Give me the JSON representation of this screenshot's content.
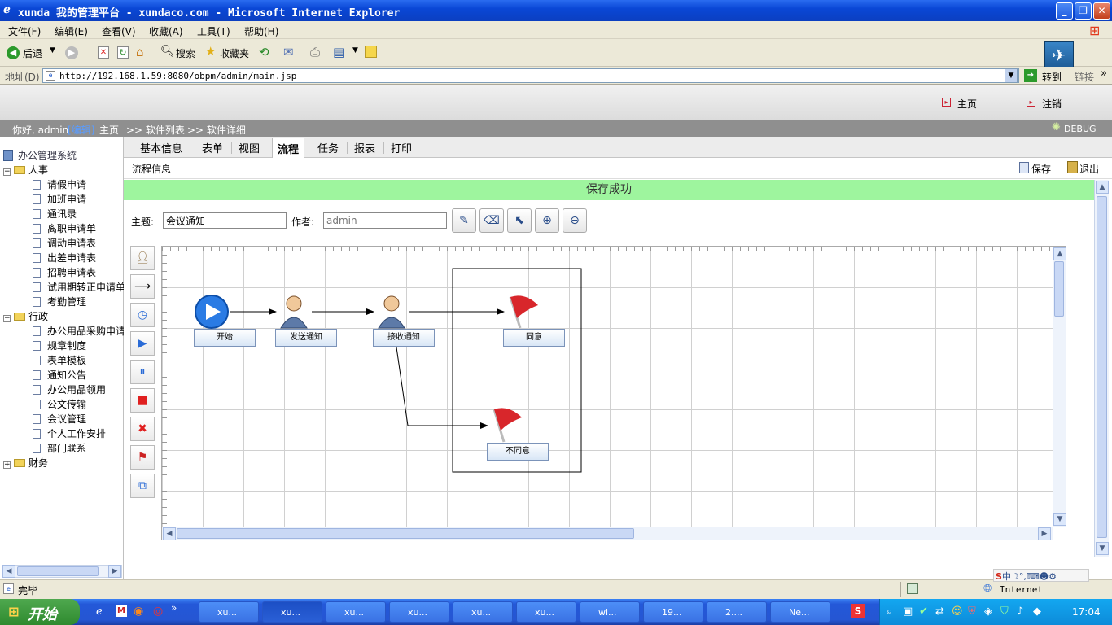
{
  "window": {
    "title": "xunda 我的管理平台 - xundaco.com - Microsoft Internet Explorer"
  },
  "menu": [
    "文件(F)",
    "编辑(E)",
    "查看(V)",
    "收藏(A)",
    "工具(T)",
    "帮助(H)"
  ],
  "toolbar": {
    "back": "后退",
    "search": "搜索",
    "favorites": "收藏夹"
  },
  "address": {
    "label": "地址(D)",
    "url": "http://192.168.1.59:8080/obpm/admin/main.jsp",
    "go": "转到",
    "links": "链接"
  },
  "header": {
    "home": "主页",
    "logout": "注销"
  },
  "nav": {
    "greeting": "你好, admin",
    "edit": "[编辑]",
    "home": "主页",
    "software_list": ">> 软件列表",
    "software_detail": ">> 软件详细",
    "debug": "DEBUG"
  },
  "sidebar": {
    "root": "办公管理系统",
    "groups": [
      {
        "name": "人事",
        "expander": "−",
        "items": [
          "请假申请",
          "加班申请",
          "通讯录",
          "离职申请单",
          "调动申请表",
          "出差申请表",
          "招聘申请表",
          "试用期转正申请单",
          "考勤管理"
        ]
      },
      {
        "name": "行政",
        "expander": "−",
        "items": [
          "办公用品采购申请",
          "规章制度",
          "表单模板",
          "通知公告",
          "办公用品领用",
          "公文传输",
          "会议管理",
          "个人工作安排",
          "部门联系"
        ]
      },
      {
        "name": "财务",
        "expander": "+",
        "items": []
      }
    ]
  },
  "tabs": [
    "基本信息",
    "表单",
    "视图",
    "流程",
    "任务",
    "报表",
    "打印"
  ],
  "active_tab": "流程",
  "flow": {
    "section_title": "流程信息",
    "save": "保存",
    "exit": "退出",
    "success_message": "保存成功",
    "subject_label": "主题:",
    "subject_value": "会议通知",
    "author_label": "作者:",
    "author_placeholder": "admin",
    "nodes": {
      "start": "开始",
      "send": "发送通知",
      "receive": "接收通知",
      "agree": "同意",
      "disagree": "不同意"
    }
  },
  "statusbar": {
    "status": "完毕",
    "zone": "Internet"
  },
  "taskbar": {
    "start": "开始",
    "items": [
      "xu...",
      "xu...",
      "xu...",
      "xu...",
      "xu...",
      "xu...",
      "wi...",
      "19...",
      "2....",
      "Ne..."
    ],
    "clock": "17:04"
  },
  "colors": {
    "success_bg": "#9ef59e",
    "title_bar": "#0a47d6",
    "nav_bg": "#8f8f8f",
    "edit_link": "#1a55c9"
  }
}
